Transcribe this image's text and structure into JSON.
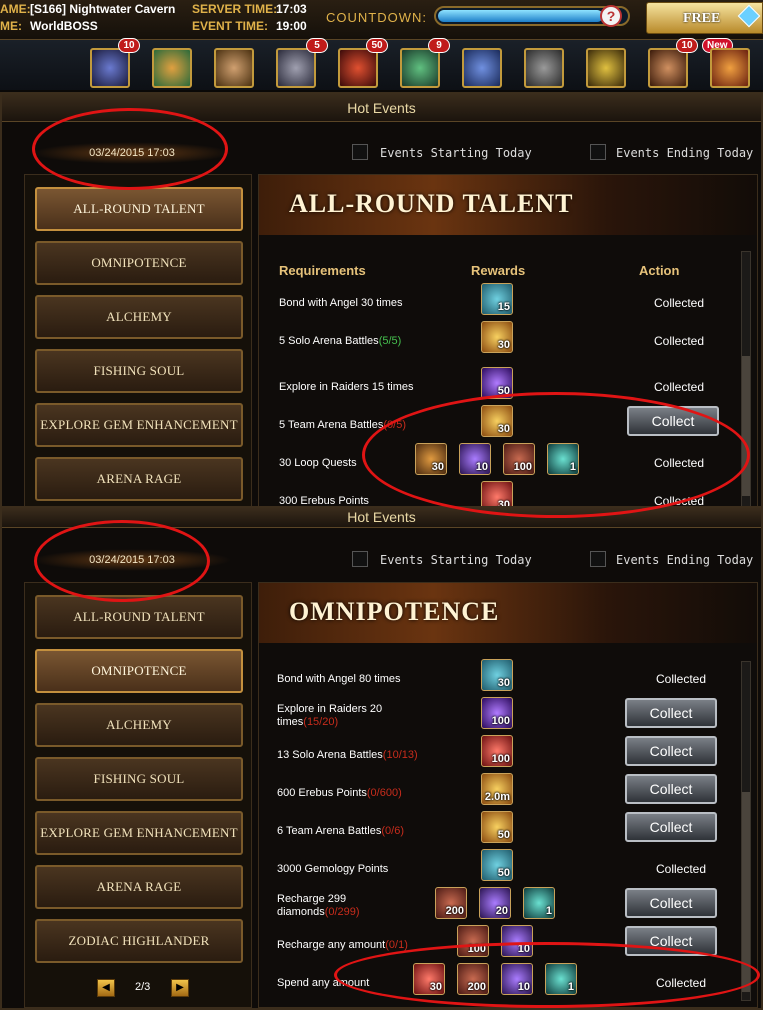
{
  "topbar": {
    "name_label": "AME:",
    "server_name": "[S166] Nightwater Cavern",
    "event_name_label": "ME:",
    "event_name": "WorldBOSS",
    "server_time_label": "SERVER TIME:",
    "server_time": "17:03",
    "event_time_label": "EVENT TIME:",
    "event_time": "19:00",
    "countdown_label": "COUNTDOWN:",
    "countdown_progress": 0.88,
    "free_label": "FREE"
  },
  "activity_badges": [
    "10",
    "5",
    "50",
    "9",
    "10",
    "New"
  ],
  "panel1": {
    "header": "Hot Events",
    "date": "03/24/2015 17:03",
    "filter_starting": "Events Starting Today",
    "filter_ending": "Events Ending Today",
    "nav": [
      "All-round Talent",
      "Omnipotence",
      "Alchemy",
      "Fishing Soul",
      "Explore Gem Enhancement",
      "Arena Rage"
    ],
    "banner_title": "All-round Talent",
    "col_requirements": "Requirements",
    "col_rewards": "Rewards",
    "col_action": "Action",
    "rows": [
      {
        "req": "Bond with Angel 30 times",
        "prog": "",
        "rewards": [
          "15"
        ],
        "action": "Collected"
      },
      {
        "req": "5 Solo Arena Battles",
        "prog": "(5/5)",
        "rewards": [
          "30"
        ],
        "action": "Collected"
      },
      {
        "req": "Explore in Raiders 15 times",
        "prog": "",
        "rewards": [
          "50"
        ],
        "action": "Collected"
      },
      {
        "req": "5 Team Arena Battles",
        "prog": "(0/5)",
        "rewards": [
          "30"
        ],
        "action": "Collect"
      },
      {
        "req": "30 Loop Quests",
        "prog": "",
        "rewards": [
          "30",
          "10",
          "100",
          "1"
        ],
        "action": "Collected"
      },
      {
        "req": "300 Erebus Points",
        "prog": "",
        "rewards": [
          "30"
        ],
        "action": "Collected"
      }
    ]
  },
  "panel2": {
    "header": "Hot Events",
    "date": "03/24/2015 17:03",
    "filter_starting": "Events Starting Today",
    "filter_ending": "Events Ending Today",
    "nav": [
      "All-round Talent",
      "Omnipotence",
      "Alchemy",
      "Fishing Soul",
      "Explore Gem Enhancement",
      "Arena Rage",
      "Zodiac Highlander"
    ],
    "banner_title": "Omnipotence",
    "pager": "2/3",
    "rows": [
      {
        "req": "Bond with Angel 80 times",
        "prog": "",
        "rewards": [
          "30"
        ],
        "action": "Collected"
      },
      {
        "req": "Explore in Raiders 20 times",
        "prog": "(15/20)",
        "rewards": [
          "100"
        ],
        "action": "Collect"
      },
      {
        "req": "13 Solo Arena Battles",
        "prog": "(10/13)",
        "rewards": [
          "100"
        ],
        "action": "Collect"
      },
      {
        "req": "600 Erebus Points",
        "prog": "(0/600)",
        "rewards": [
          "2.0m"
        ],
        "action": "Collect"
      },
      {
        "req": "6 Team Arena Battles",
        "prog": "(0/6)",
        "rewards": [
          "50"
        ],
        "action": "Collect"
      },
      {
        "req": "3000 Gemology Points",
        "prog": "",
        "rewards": [
          "50"
        ],
        "action": "Collected"
      },
      {
        "req": "Recharge 299 diamonds",
        "prog": "(0/299)",
        "rewards": [
          "200",
          "20",
          "1"
        ],
        "action": "Collect"
      },
      {
        "req": "Recharge any amount",
        "prog": "(0/1)",
        "rewards": [
          "100",
          "10"
        ],
        "action": "Collect"
      },
      {
        "req": "Spend any amount",
        "prog": "",
        "rewards": [
          "30",
          "200",
          "10",
          "1"
        ],
        "action": "Collected"
      }
    ]
  }
}
